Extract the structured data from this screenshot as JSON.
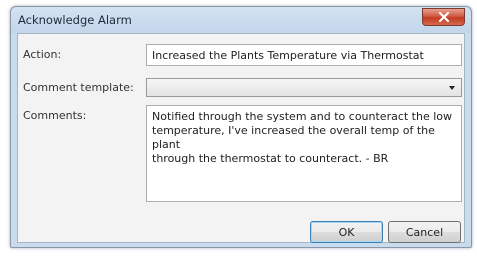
{
  "window": {
    "title": "Acknowledge Alarm"
  },
  "form": {
    "action_label": "Action:",
    "action_value": "Increased the Plants Temperature via Thermostat",
    "template_label": "Comment template:",
    "template_value": "",
    "comments_label": "Comments:",
    "comments_value": "Notified through the system and to counteract the low\ntemperature, I've increased the overall temp of the plant\nthrough the thermostat to counteract. - BR"
  },
  "buttons": {
    "ok_label": "OK",
    "cancel_label": "Cancel"
  },
  "icons": {
    "close": "close-icon",
    "dropdown": "chevron-down-icon"
  },
  "colors": {
    "close_button": "#c23b22",
    "title_bar": "#c3d6ea"
  }
}
